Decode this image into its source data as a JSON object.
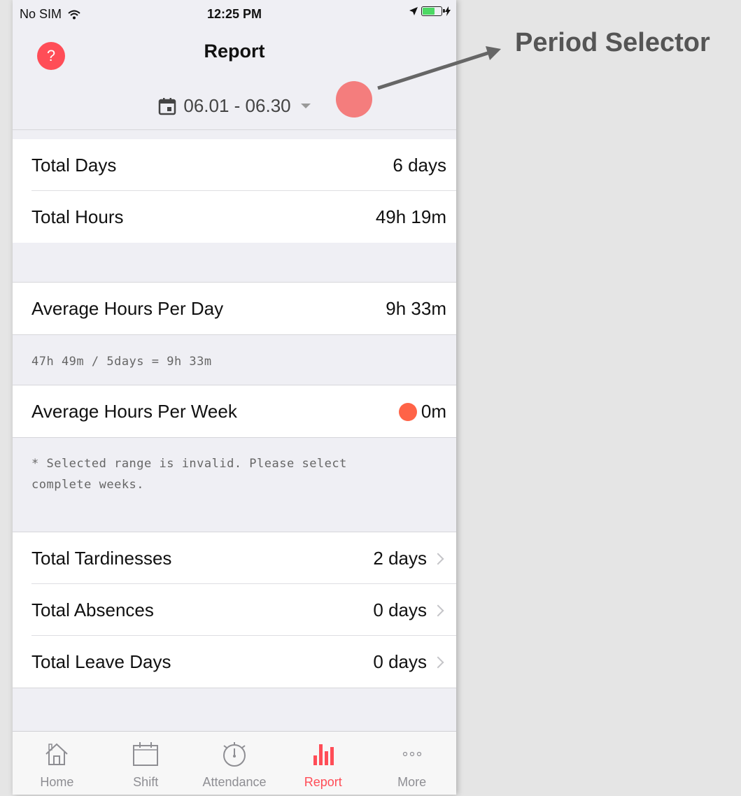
{
  "status_bar": {
    "carrier": "No SIM",
    "time": "12:25 PM"
  },
  "header": {
    "help_label": "?",
    "title": "Report",
    "period": "06.01 - 06.30"
  },
  "summary": [
    {
      "label": "Total Days",
      "value": "6 days"
    },
    {
      "label": "Total Hours",
      "value": "49h 19m"
    }
  ],
  "average_day": {
    "label": "Average Hours Per Day",
    "value": "9h 33m",
    "note": "47h 49m / 5days = 9h 33m"
  },
  "average_week": {
    "label": "Average Hours Per Week",
    "value": "0m",
    "note_line1": "* Selected range is invalid. Please select",
    "note_line2": "complete weeks."
  },
  "details": [
    {
      "label": "Total Tardinesses",
      "value": "2 days"
    },
    {
      "label": "Total Absences",
      "value": "0 days"
    },
    {
      "label": "Total Leave Days",
      "value": "0 days"
    }
  ],
  "tabs": [
    {
      "label": "Home",
      "icon": "home-icon"
    },
    {
      "label": "Shift",
      "icon": "calendar-icon"
    },
    {
      "label": "Attendance",
      "icon": "stopwatch-icon"
    },
    {
      "label": "Report",
      "icon": "bar-chart-icon",
      "active": true
    },
    {
      "label": "More",
      "icon": "more-icon"
    }
  ],
  "annotation": {
    "text": "Period Selector"
  },
  "colors": {
    "accent": "#ff4d57",
    "marker": "#f47d7d",
    "warning_dot": "#ff6347"
  }
}
